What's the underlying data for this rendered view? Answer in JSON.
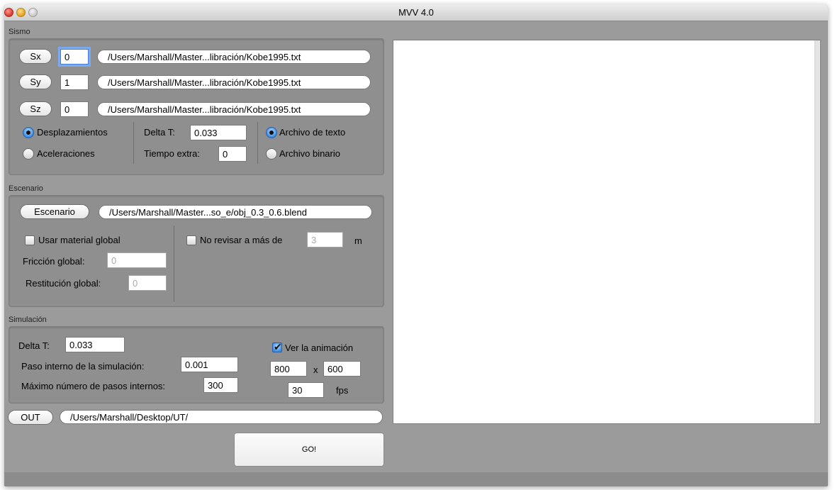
{
  "window": {
    "title": "MVV 4.0"
  },
  "sismo": {
    "section_label": "Sismo",
    "channels": [
      {
        "button": "Sx",
        "value": "0",
        "path": "/Users/Marshall/Master...libración/Kobe1995.txt"
      },
      {
        "button": "Sy",
        "value": "1",
        "path": "/Users/Marshall/Master...libración/Kobe1995.txt"
      },
      {
        "button": "Sz",
        "value": "0",
        "path": "/Users/Marshall/Master...libración/Kobe1995.txt"
      }
    ],
    "data_type": {
      "options": [
        "Desplazamientos",
        "Aceleraciones"
      ],
      "selected": "Desplazamientos"
    },
    "delta_t_label": "Delta T:",
    "delta_t_value": "0.033",
    "tiempo_extra_label": "Tiempo extra:",
    "tiempo_extra_value": "0",
    "file_format": {
      "options": [
        "Archivo de texto",
        "Archivo binario"
      ],
      "selected": "Archivo de texto"
    }
  },
  "escenario": {
    "section_label": "Escenario",
    "button": "Escenario",
    "path": "/Users/Marshall/Master...so_e/obj_0.3_0.6.blend",
    "usar_material_global_label": "Usar material global",
    "usar_material_global_checked": false,
    "friccion_label": "Fricción global:",
    "friccion_value": "0",
    "restitucion_label": "Restitución global:",
    "restitucion_value": "0",
    "no_revisar_label": "No revisar a más de",
    "no_revisar_checked": false,
    "no_revisar_value": "3",
    "no_revisar_unit": "m"
  },
  "simulacion": {
    "section_label": "Simulación",
    "delta_t_label": "Delta T:",
    "delta_t_value": "0.033",
    "paso_interno_label": "Paso interno de la simulación:",
    "paso_interno_value": "0.001",
    "max_pasos_label": "Máximo número de pasos internos:",
    "max_pasos_value": "300",
    "ver_animacion_label": "Ver la animación",
    "ver_animacion_checked": true,
    "width_value": "800",
    "by_label": "x",
    "height_value": "600",
    "fps_value": "30",
    "fps_label": "fps"
  },
  "output": {
    "button": "OUT",
    "path": "/Users/Marshall/Desktop/UT/"
  },
  "go_button": "GO!"
}
